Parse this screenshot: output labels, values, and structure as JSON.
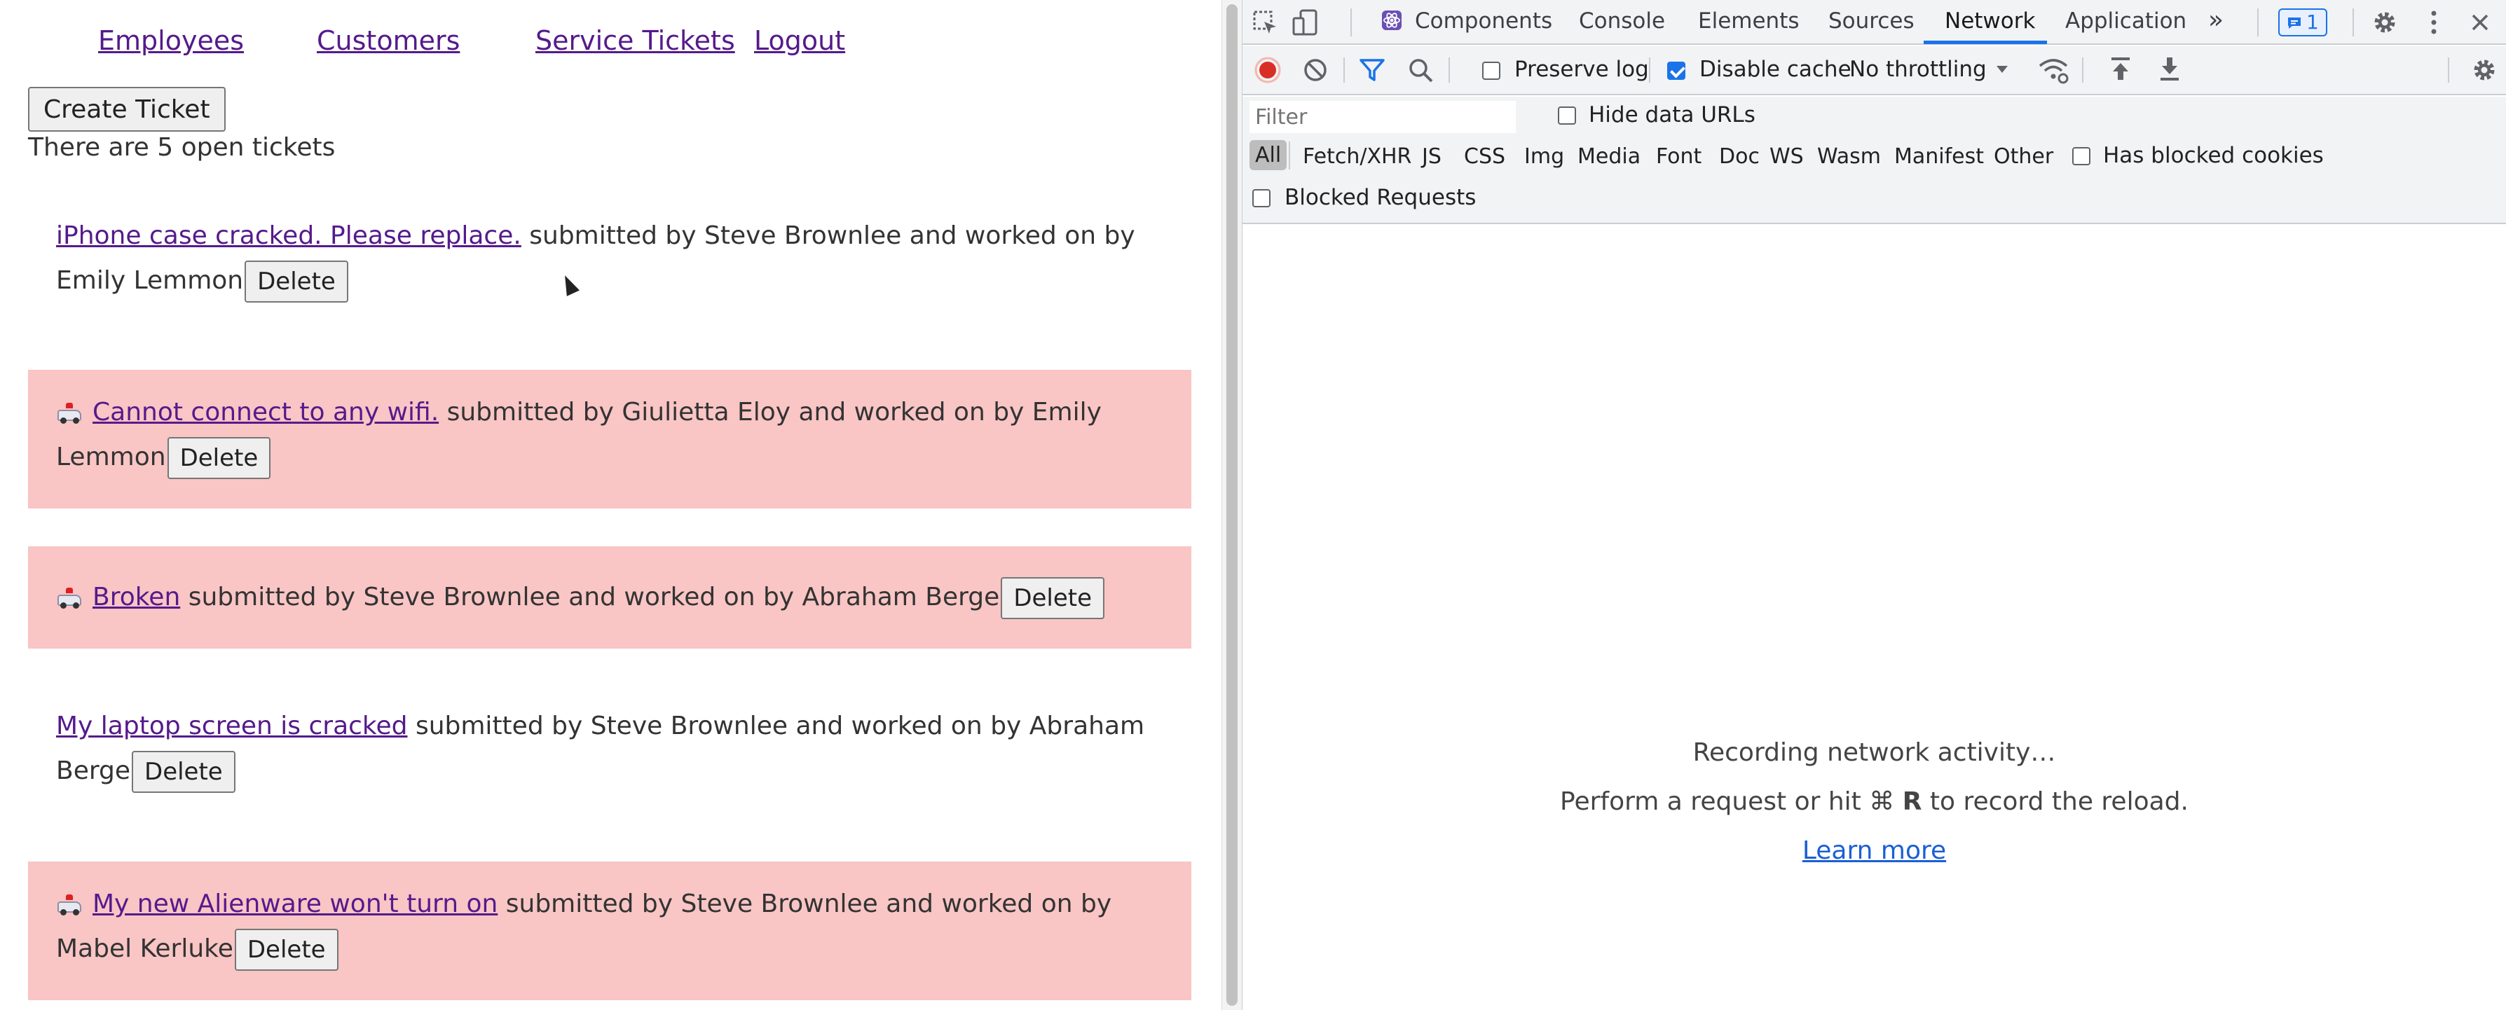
{
  "nav": {
    "employees": "Employees",
    "customers": "Customers",
    "service_tickets": "Service Tickets",
    "logout": "Logout"
  },
  "create_ticket_label": "Create Ticket",
  "open_count_text": "There are 5 open tickets",
  "tickets": [
    {
      "emergency": false,
      "description": "iPhone case cracked. Please replace.",
      "line1_rest": " submitted by Steve Brownlee and worked on by",
      "line2": "Emily Lemmon",
      "delete_label": "Delete"
    },
    {
      "emergency": true,
      "icon": "ambulance-icon",
      "description": "Cannot connect to any wifi.",
      "line1_rest": " submitted by Giulietta Eloy and worked on by Emily",
      "line2": "Lemmon",
      "delete_label": "Delete"
    },
    {
      "emergency": true,
      "icon": "ambulance-icon",
      "description": "Broken",
      "line1_rest": " submitted by Steve Brownlee and worked on by Abraham Berge",
      "line2": "",
      "delete_label": "Delete"
    },
    {
      "emergency": false,
      "description": "My laptop screen is cracked",
      "line1_rest": " submitted by Steve Brownlee and worked on by Abraham",
      "line2": "Berge",
      "delete_label": "Delete"
    },
    {
      "emergency": true,
      "icon": "ambulance-icon",
      "description": "My new Alienware won't turn on",
      "line1_rest": " submitted by Steve Brownlee and worked on by",
      "line2": "Mabel Kerluke",
      "delete_label": "Delete"
    }
  ],
  "devtools": {
    "tabs": [
      "Components",
      "Console",
      "Elements",
      "Sources",
      "Network",
      "Application"
    ],
    "active_tab": "Network",
    "more_tabs": "»",
    "message_count": "1",
    "preserve_log": "Preserve log",
    "preserve_log_checked": false,
    "disable_cache": "Disable cache",
    "disable_cache_checked": true,
    "throttling": "No throttling",
    "filter_placeholder": "Filter",
    "hide_data_urls": "Hide data URLs",
    "types": [
      "All",
      "Fetch/XHR",
      "JS",
      "CSS",
      "Img",
      "Media",
      "Font",
      "Doc",
      "WS",
      "Wasm",
      "Manifest",
      "Other"
    ],
    "has_blocked_cookies": "Has blocked cookies",
    "blocked_requests": "Blocked Requests",
    "recording_text": "Recording network activity…",
    "hint_prefix": "Perform a request or hit ⌘ ",
    "hint_key": "R",
    "hint_suffix": " to record the reload.",
    "learn_more": "Learn more"
  },
  "colors": {
    "emergency_bg": "#f9c5c5",
    "link": "#551a8b",
    "devtools_accent": "#1a73e8",
    "record_red": "#d93025"
  }
}
